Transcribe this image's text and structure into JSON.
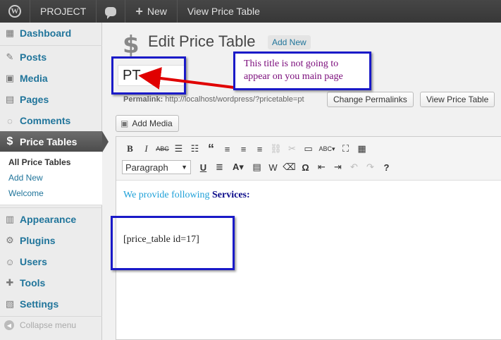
{
  "adminbar": {
    "site_name": "PROJECT",
    "new_label": "New",
    "view_label": "View Price Table"
  },
  "sidebar": {
    "items": [
      {
        "label": "Dashboard"
      },
      {
        "label": "Posts"
      },
      {
        "label": "Media"
      },
      {
        "label": "Pages"
      },
      {
        "label": "Comments"
      },
      {
        "label": "Price Tables"
      },
      {
        "label": "Appearance"
      },
      {
        "label": "Plugins"
      },
      {
        "label": "Users"
      },
      {
        "label": "Tools"
      },
      {
        "label": "Settings"
      }
    ],
    "submenu": [
      "All Price Tables",
      "Add New",
      "Welcome"
    ],
    "collapse_label": "Collapse menu"
  },
  "page": {
    "title": "Edit Price Table",
    "add_new": "Add New",
    "post_title_value": "PT",
    "permalink_label": "Permalink:",
    "permalink_url": "http://localhost/wordpress/?pricetable=pt",
    "change_permalinks": "Change Permalinks",
    "view_price_table": "View Price Table",
    "add_media": "Add Media"
  },
  "editor": {
    "format_select": "Paragraph",
    "line1_plain": "We provide following",
    "line1_bold": "Services:",
    "shortcode": "[price_table id=17]"
  },
  "annotation": {
    "callout_text": "This title is not going to appear on you main page"
  },
  "colors": {
    "link": "#21759b",
    "annotation_blue": "#1a1ac8",
    "arrow_red": "#e00000",
    "callout_text": "#7a0a7a"
  }
}
